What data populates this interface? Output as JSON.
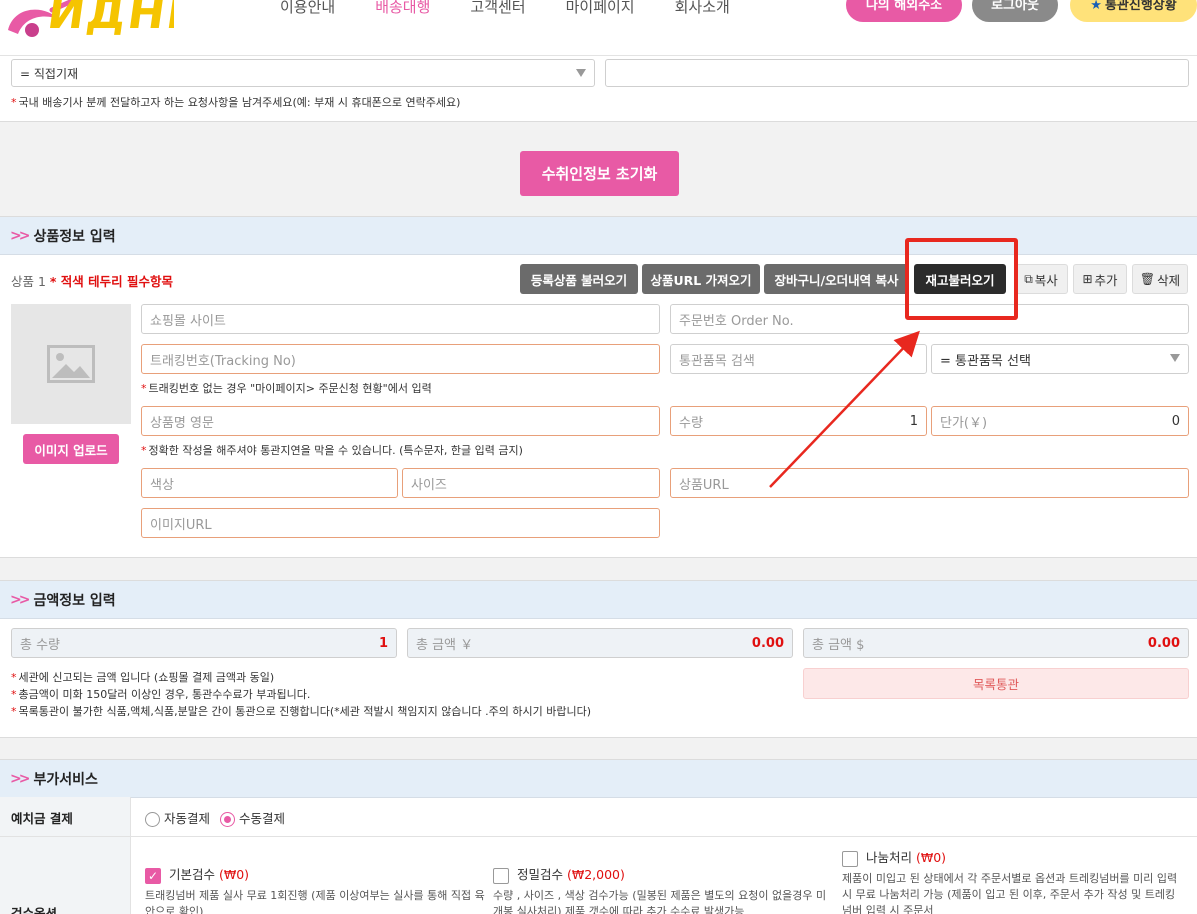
{
  "header": {
    "nav": [
      "이용안내",
      "배송대행",
      "고객센터",
      "마이페이지",
      "회사소개"
    ],
    "active_nav": "배송대행",
    "my_address_button": "나의 해외주소",
    "logout_button": "로그아웃",
    "customs_status_button": "통관진행상황",
    "customs_status_icon": "star-icon"
  },
  "delivery": {
    "request_select": "= 직접기재",
    "request_note": "국내 배송기사 분께 전달하고자 하는 요청사항을 남겨주세요(예: 부재 시 휴대폰으로 연락주세요)",
    "reset_button": "수취인정보 초기화"
  },
  "product": {
    "section_title": "상품정보 입력",
    "item_label": "상품 1",
    "required_note": "* 적색 테두리 필수항목",
    "buttons": {
      "load_registered": "등록상품 불러오기",
      "fetch_url": "상품URL 가져오기",
      "copy_cart": "장바구니/오더내역 복사",
      "load_stock": "재고불러오기",
      "copy": "복사",
      "add": "추가",
      "delete": "삭제"
    },
    "image_upload_button": "이미지 업로드",
    "placeholders": {
      "shop_site": "쇼핑몰 사이트",
      "order_no": "주문번호 Order No.",
      "tracking": "트래킹번호(Tracking No)",
      "customs_search": "통관품목 검색",
      "name_en": "상품명 영문",
      "quantity": "수량",
      "unit_price": "단가(￥)",
      "color": "색상",
      "size": "사이즈",
      "product_url": "상품URL",
      "image_url": "이미지URL"
    },
    "customs_select": "= 통관품목 선택",
    "quantity_value": "1",
    "unit_price_value": "0",
    "tracking_note": "트래킹번호 없는 경우 \"마이페이지> 주문신청 현황\"에서 입력",
    "name_note": "정확한 작성을 해주셔야 통관지연을 막을 수 있습니다. (특수문자, 한글 입력 금지)"
  },
  "amount": {
    "section_title": "금액정보 입력",
    "total_qty_label": "총 수량",
    "total_qty_value": "1",
    "total_yen_label": "총 금액 ￥",
    "total_yen_value": "0.00",
    "total_usd_label": "총 금액 $",
    "total_usd_value": "0.00",
    "notes": [
      "세관에 신고되는 금액 입니다 (쇼핑몰 결제 금액과 동일)",
      "총금액이 미화 150달러 이상인 경우, 통관수수료가 부과됩니다.",
      "목록통관이 불가한 식품,액체,식품,분말은 간이 통관으로 진행합니다(*세관 적발시 책임지지 않습니다 .주의 하시기 바랍니다)"
    ],
    "clearance_type": "목록통관"
  },
  "extra": {
    "section_title": "부가서비스",
    "deposit_label": "예치금 결제",
    "auto_pay": "자동결제",
    "manual_pay": "수동결제",
    "inspection_label": "검수옵션",
    "basic_inspection": "기본검수",
    "basic_price": "(₩0)",
    "basic_desc": "트래킹넘버 제품 실사 무료 1회진행 (제품 이상여부는 실사를 통해 직접 육안으로 확인)",
    "precise_inspection": "정밀검수",
    "precise_price": "(₩2,000)",
    "precise_desc": "수량 , 사이즈 , 색상 검수가능 (밀봉된 제품은 별도의 요청이 없을경우 미개봉 실사처리) 제품 갯수에 따라 추가 수수료 발생가능",
    "split_service": "나눔처리",
    "split_price": "(₩0)",
    "split_desc": "제품이 미입고 된 상태에서 각 주문서별로 옵션과 트레킹넘버를 미리 입력시 무료 나눔처리 가능 (제품이 입고 된 이후, 주문서 추가 작성 및 트레킹넘버 입력 시 주문서"
  },
  "colors": {
    "accent": "#e85aa5",
    "annotation": "#e8281f",
    "section_bg": "#e4eef8"
  }
}
